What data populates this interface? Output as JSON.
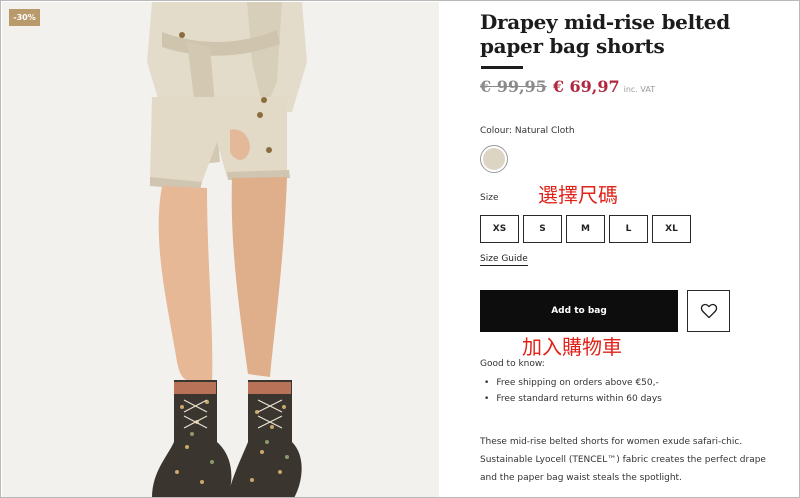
{
  "badge": {
    "discount": "-30%"
  },
  "product": {
    "title": "Drapey mid-rise belted paper bag shorts",
    "old_price": "€ 99,95",
    "new_price": "€ 69,97",
    "vat_note": "inc. VAT"
  },
  "colour": {
    "label": "Colour: Natural Cloth",
    "swatch_color": "#ddd5c3"
  },
  "size": {
    "label": "Size",
    "options": [
      "XS",
      "S",
      "M",
      "L",
      "XL"
    ],
    "guide_label": "Size Guide"
  },
  "annotations": {
    "select_size": "選擇尺碼",
    "add_to_cart": "加入購物車"
  },
  "actions": {
    "add_to_bag": "Add to bag",
    "wishlist_icon": "heart-icon"
  },
  "good_to_know": {
    "label": "Good to know:",
    "items": [
      "Free shipping on orders above €50,-",
      "Free standard returns within 60 days"
    ]
  },
  "description": "These mid-rise belted shorts for women exude safari-chic. Sustainable Lyocell (TENCEL™) fabric creates the perfect drape and the paper bag waist steals the spotlight.",
  "colors": {
    "accent_red": "#b0263d",
    "annotation_red": "#e0231a",
    "badge": "#b99a6c",
    "button": "#0d0d0d"
  }
}
